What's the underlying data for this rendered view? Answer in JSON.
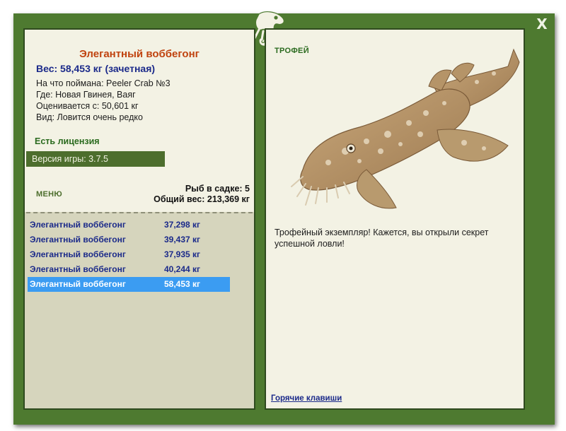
{
  "window": {
    "close_label": "X"
  },
  "fish": {
    "title": "Элегантный воббегонг",
    "weight_line": "Вес: 58,453 кг (зачетная)",
    "bait": "На что поймана: Peeler Crab №3",
    "location": "Где: Новая Гвинея, Ваяг",
    "scored_from": "Оценивается с: 50,601 кг",
    "rarity": "Вид: Ловится очень редко"
  },
  "license": "Есть лицензия",
  "version": "Версия игры: 3.7.5",
  "menu_label": "МЕНЮ",
  "stats": {
    "keepnet": "Рыб в садке: 5",
    "total_weight": "Общий вес: 213,369 кг"
  },
  "catches": [
    {
      "name": "Элегантный воббегонг",
      "weight": "37,298 кг"
    },
    {
      "name": "Элегантный воббегонг",
      "weight": "39,437 кг"
    },
    {
      "name": "Элегантный воббегонг",
      "weight": "37,935 кг"
    },
    {
      "name": "Элегантный воббегонг",
      "weight": "40,244 кг"
    },
    {
      "name": "Элегантный воббегонг",
      "weight": "58,453 кг"
    }
  ],
  "selected_catch_index": 4,
  "trophy": {
    "label": "ТРОФЕЙ",
    "text": "Трофейный экземпляр! Кажется, вы открыли секрет успешной ловли!"
  },
  "hotkeys_label": "Горячие клавиши",
  "colors": {
    "frame": "#4e7a30",
    "panel": "#f3f2e4",
    "list_bg": "#d6d5bd",
    "title": "#c0430f",
    "link": "#1b2a8a",
    "selection": "#3b9cf2"
  }
}
